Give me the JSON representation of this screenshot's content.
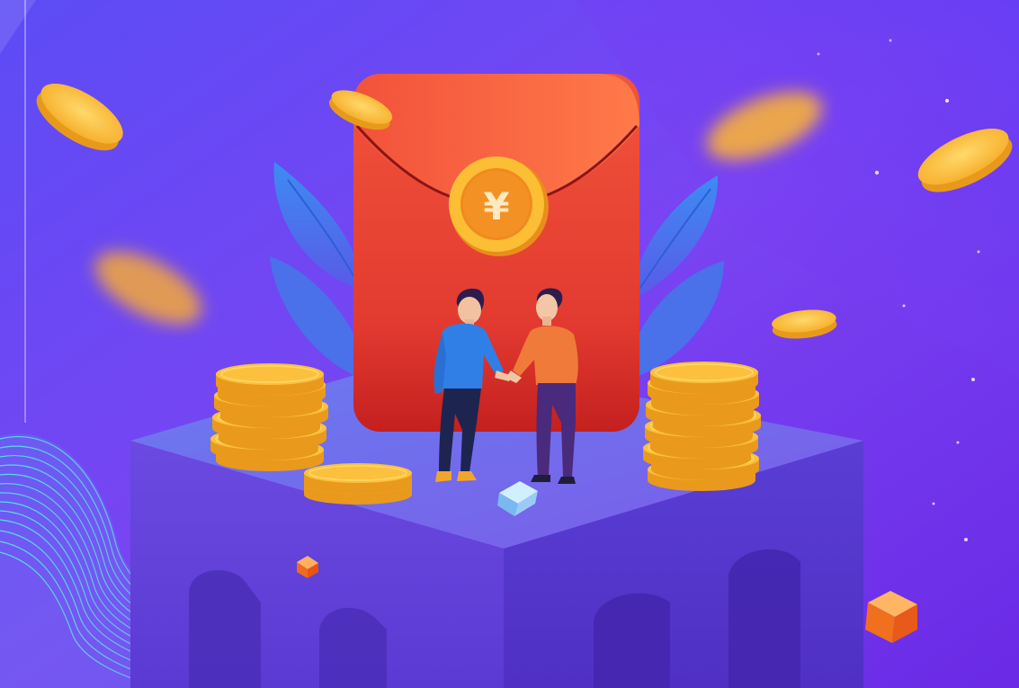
{
  "envelope": {
    "symbol": "¥"
  },
  "colors": {
    "background_top": "#7a4dff",
    "background_bottom": "#6a2ae6",
    "envelope_red": "#e03a30",
    "envelope_flap": "#f05a3a",
    "coin_gold": "#f7b22f",
    "coin_gold_light": "#ffd25a",
    "coin_gold_dark": "#e79a1a",
    "block_top": "#6b5ae8",
    "block_left": "#5a3fd0",
    "block_right": "#5334c8",
    "leaf_blue": "#4a7cf0",
    "man_left_shirt": "#2f7fe6",
    "man_right_shirt": "#f07a3a",
    "wave_cyan": "#57e3e0"
  },
  "icons": [
    "yen-coin-icon",
    "red-envelope-icon",
    "gold-coin-icon",
    "cube-icon"
  ]
}
